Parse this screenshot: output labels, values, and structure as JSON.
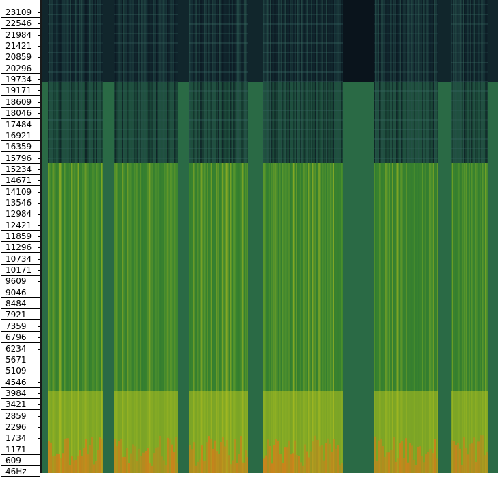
{
  "frequency_axis": {
    "labels": [
      "23109",
      "22546",
      "21984",
      "21421",
      "20859",
      "20296",
      "19734",
      "19171",
      "18609",
      "18046",
      "17484",
      "16921",
      "16359",
      "15796",
      "15234",
      "14671",
      "14109",
      "13546",
      "12984",
      "12421",
      "11859",
      "11296",
      "10734",
      "10171",
      "9609",
      "9046",
      "8484",
      "7921",
      "7359",
      "6796",
      "6234",
      "5671",
      "5109",
      "4546",
      "3984",
      "3421",
      "2859",
      "2296",
      "1734",
      "1171",
      "609",
      "46Hz"
    ]
  },
  "spectrogram": {
    "colors": {
      "background_band": "#1f5e42",
      "high_band": "#0f1f2b",
      "mid_band": "#1d4a3a",
      "low_green": "#3f8a2a",
      "yellow": "#b7c21f",
      "orange": "#d97a1a",
      "silence": "#2a6a45"
    }
  }
}
